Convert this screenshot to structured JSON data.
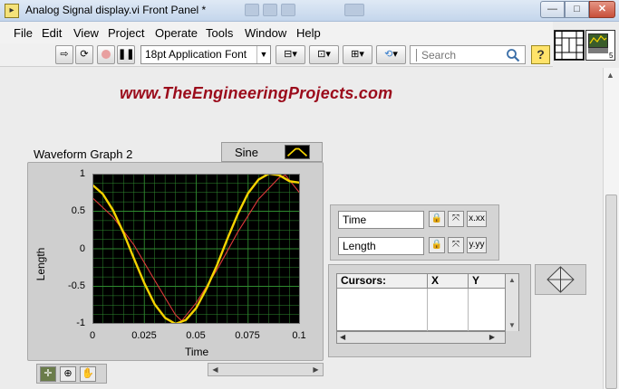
{
  "window": {
    "title": "Analog Signal display.vi Front Panel *",
    "controls": {
      "minimize": "—",
      "maximize": "□",
      "close": "✕"
    }
  },
  "menu": [
    "File",
    "Edit",
    "View",
    "Project",
    "Operate",
    "Tools",
    "Window",
    "Help"
  ],
  "toolbar": {
    "font": "18pt Application Font",
    "search_placeholder": "Search",
    "help": "?"
  },
  "panel": {
    "watermark": "www.TheEngineeringProjects.com"
  },
  "graph": {
    "label": "Waveform Graph 2",
    "legend_name": "Sine",
    "y_label": "Length",
    "x_label": "Time",
    "y_ticks": [
      "1",
      "0.5",
      "0",
      "-0.5",
      "-1"
    ],
    "x_ticks": [
      "0",
      "0.025",
      "0.05",
      "0.075",
      "0.1"
    ]
  },
  "chart_data": {
    "type": "line",
    "xlabel": "Time",
    "ylabel": "Length",
    "xlim": [
      0,
      0.1
    ],
    "ylim": [
      -1,
      1
    ],
    "grid": true,
    "background": "#000000",
    "grid_color": "#2f8a2f",
    "series": [
      {
        "name": "Sine",
        "color": "#f5d300",
        "x": [
          0,
          0.005,
          0.01,
          0.015,
          0.02,
          0.025,
          0.03,
          0.035,
          0.04,
          0.045,
          0.05,
          0.055,
          0.06,
          0.065,
          0.07,
          0.075,
          0.08,
          0.085,
          0.09,
          0.095,
          0.1
        ],
        "y": [
          0.85,
          0.73,
          0.51,
          0.21,
          -0.13,
          -0.46,
          -0.74,
          -0.92,
          -1.0,
          -0.95,
          -0.79,
          -0.53,
          -0.22,
          0.13,
          0.46,
          0.74,
          0.92,
          1.0,
          0.98,
          0.9,
          0.88
        ]
      },
      {
        "color": "#e03a3a",
        "x": [
          0,
          0.01,
          0.02,
          0.03,
          0.04,
          0.043,
          0.05,
          0.06,
          0.07,
          0.08,
          0.09,
          0.093,
          0.1
        ],
        "y": [
          0.68,
          0.42,
          0.05,
          -0.42,
          -0.88,
          -0.96,
          -0.72,
          -0.28,
          0.22,
          0.66,
          0.95,
          0.98,
          0.74
        ]
      }
    ]
  },
  "axes": {
    "x_name": "Time",
    "y_name": "Length"
  },
  "cursors": {
    "columns": [
      "Cursors:",
      "X",
      "Y"
    ]
  }
}
